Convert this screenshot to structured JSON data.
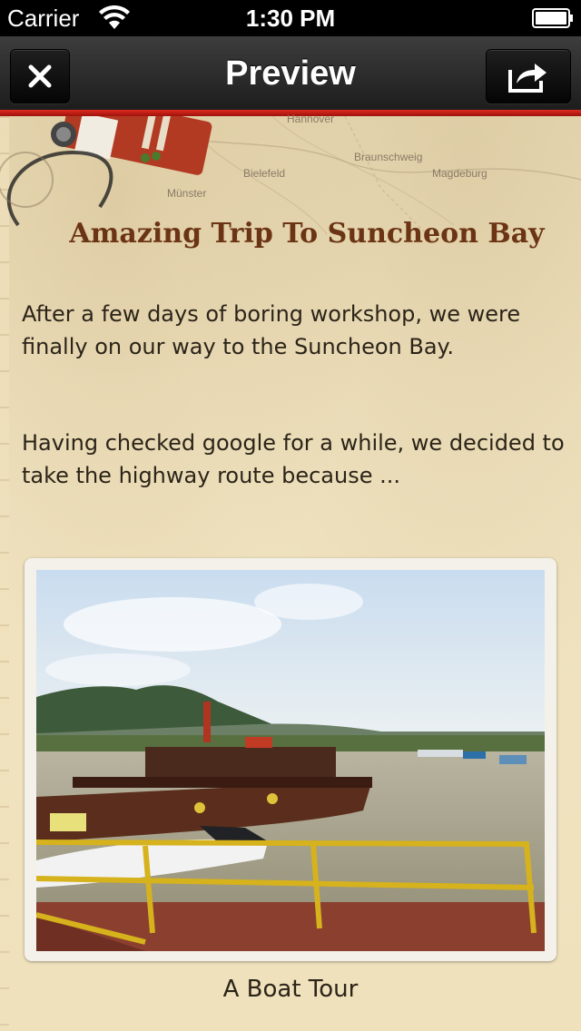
{
  "status_bar": {
    "carrier": "Carrier",
    "time": "1:30 PM",
    "wifi_icon": "wifi-icon",
    "battery_icon": "battery-icon"
  },
  "nav_bar": {
    "title": "Preview",
    "close_icon": "close-icon",
    "share_icon": "share-icon",
    "accent_color": "#d02218"
  },
  "header_map": {
    "labels": [
      "Braunschweig",
      "Bielefeld",
      "Münster",
      "Magdeburg",
      "Hannover"
    ]
  },
  "article": {
    "title": "Amazing Trip To Suncheon Bay",
    "title_color": "#6b3414",
    "paragraph_1": "After a few days of boring workshop, we were finally on our way to the Suncheon Bay.",
    "paragraph_2": "Having checked google for a while, we decided to take the highway route because ..."
  },
  "photo": {
    "caption": "A Boat Tour"
  }
}
